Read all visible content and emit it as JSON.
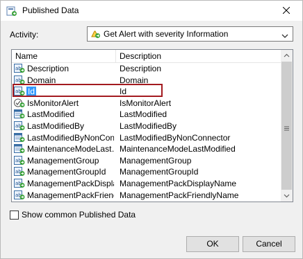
{
  "window": {
    "title": "Published Data",
    "title_icon": "published-data-icon",
    "close_icon": "close-icon"
  },
  "activity": {
    "label": "Activity:",
    "selected": "Get Alert with severity Information",
    "icon": "get-alert-icon"
  },
  "list": {
    "columns": {
      "name": "Name",
      "description": "Description"
    },
    "selected_index": 2,
    "rows": [
      {
        "name": "Description",
        "description": "Description",
        "icon": "text-property-icon"
      },
      {
        "name": "Domain",
        "description": "Domain",
        "icon": "text-property-icon"
      },
      {
        "name": "Id",
        "description": "Id",
        "icon": "text-property-icon"
      },
      {
        "name": "IsMonitorAlert",
        "description": "IsMonitorAlert",
        "icon": "boolean-property-icon"
      },
      {
        "name": "LastModified",
        "description": "LastModified",
        "icon": "datetime-property-icon"
      },
      {
        "name": "LastModifiedBy",
        "description": "LastModifiedBy",
        "icon": "text-property-icon"
      },
      {
        "name": "LastModifiedByNonCon…",
        "description": "LastModifiedByNonConnector",
        "icon": "datetime-property-icon"
      },
      {
        "name": "MaintenanceModeLast…",
        "description": "MaintenanceModeLastModified",
        "icon": "datetime-property-icon"
      },
      {
        "name": "ManagementGroup",
        "description": "ManagementGroup",
        "icon": "text-property-icon"
      },
      {
        "name": "ManagementGroupId",
        "description": "ManagementGroupId",
        "icon": "text-property-icon"
      },
      {
        "name": "ManagementPackDispla…",
        "description": "ManagementPackDisplayName",
        "icon": "text-property-icon"
      },
      {
        "name": "ManagementPackFriend…",
        "description": "ManagementPackFriendlyName",
        "icon": "text-property-icon"
      }
    ]
  },
  "show_common": {
    "label": "Show common Published Data",
    "checked": false
  },
  "buttons": {
    "ok": "OK",
    "cancel": "Cancel"
  },
  "colors": {
    "selection": "#3399ff",
    "highlight_border": "#a31a1f"
  }
}
